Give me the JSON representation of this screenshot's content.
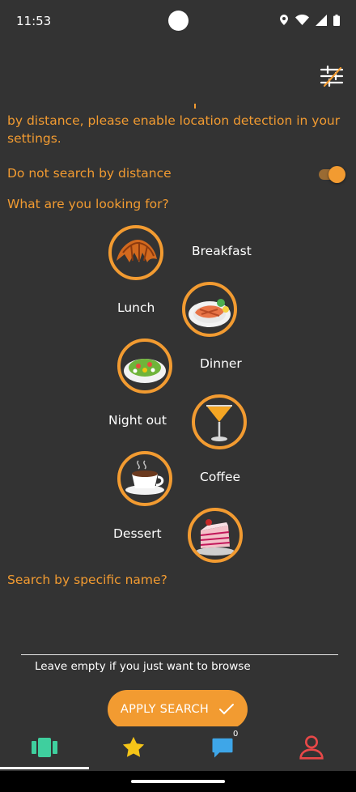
{
  "status_bar": {
    "time": "11:53"
  },
  "location_notice": "by distance, please enable location detection in your settings.",
  "distance_toggle": {
    "label": "Do not search by distance",
    "on": true
  },
  "categories_question": "What are you looking for?",
  "categories": [
    {
      "label": "Breakfast",
      "icon": "croissant-icon"
    },
    {
      "label": "Lunch",
      "icon": "salmon-plate-icon"
    },
    {
      "label": "Dinner",
      "icon": "salad-plate-icon"
    },
    {
      "label": "Night out",
      "icon": "cocktail-icon"
    },
    {
      "label": "Coffee",
      "icon": "coffee-cup-icon"
    },
    {
      "label": "Dessert",
      "icon": "cake-icon"
    }
  ],
  "name_search": {
    "label": "Search by specific name?",
    "value": "",
    "helper": "Leave empty if you just want to browse"
  },
  "apply_button": {
    "label": "APPLY SEARCH"
  },
  "bottom_nav": {
    "items": [
      {
        "name": "browse",
        "icon": "cards-icon",
        "active": true
      },
      {
        "name": "favorites",
        "icon": "star-icon"
      },
      {
        "name": "messages",
        "icon": "chat-icon",
        "badge": "0"
      },
      {
        "name": "profile",
        "icon": "person-icon"
      }
    ]
  },
  "colors": {
    "accent": "#f29b31",
    "background": "#333333",
    "nav_green": "#3fcf9e",
    "nav_star": "#f5c518",
    "nav_chat": "#3ea6e8",
    "nav_profile": "#e84848"
  }
}
